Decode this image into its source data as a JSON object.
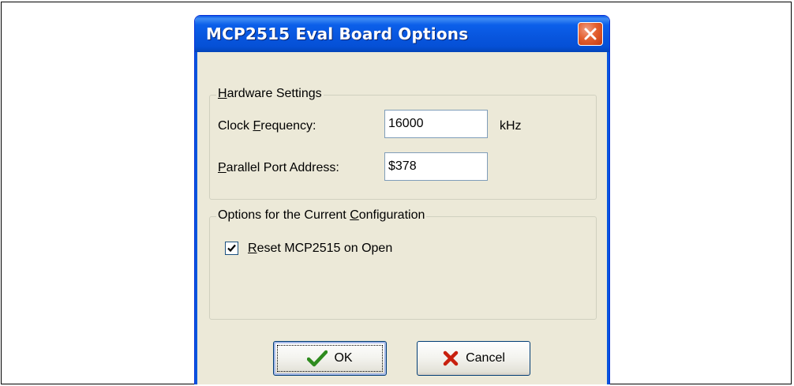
{
  "dialog": {
    "title": "MCP2515 Eval Board Options",
    "close_icon": "close-icon"
  },
  "hardware": {
    "legend_prefix": "H",
    "legend_rest": "ardware Settings",
    "clock_label_pre": "Clock ",
    "clock_label_key": "F",
    "clock_label_post": "requency:",
    "clock_value": "16000",
    "clock_unit": "kHz",
    "port_label_key": "P",
    "port_label_post": "arallel Port Address:",
    "port_value": "$378"
  },
  "options": {
    "legend_pre": "Options for the Current ",
    "legend_key": "C",
    "legend_post": "onfiguration",
    "reset_key": "R",
    "reset_post": "eset MCP2515 on Open",
    "reset_checked": true
  },
  "buttons": {
    "ok_label": "OK",
    "cancel_label": "Cancel",
    "ok_icon": "checkmark-icon",
    "cancel_icon": "cross-icon"
  },
  "colors": {
    "titlebar": "#0855dd",
    "dialog_bg": "#ece9d8",
    "close_button": "#e4602f",
    "ok_check": "#2e8b1e",
    "cancel_cross": "#c8200e"
  }
}
